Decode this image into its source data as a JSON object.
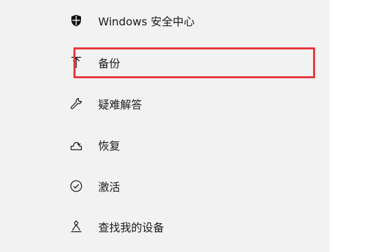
{
  "nav": {
    "items": [
      {
        "label": "Windows 安全中心",
        "icon": "shield-icon"
      },
      {
        "label": "备份",
        "icon": "backup-arrow-icon"
      },
      {
        "label": "疑难解答",
        "icon": "wrench-icon"
      },
      {
        "label": "恢复",
        "icon": "recovery-icon"
      },
      {
        "label": "激活",
        "icon": "check-circle-icon"
      },
      {
        "label": "查找我的设备",
        "icon": "find-device-icon"
      }
    ]
  },
  "highlight": {
    "target": "备份",
    "color": "#e8383d"
  }
}
